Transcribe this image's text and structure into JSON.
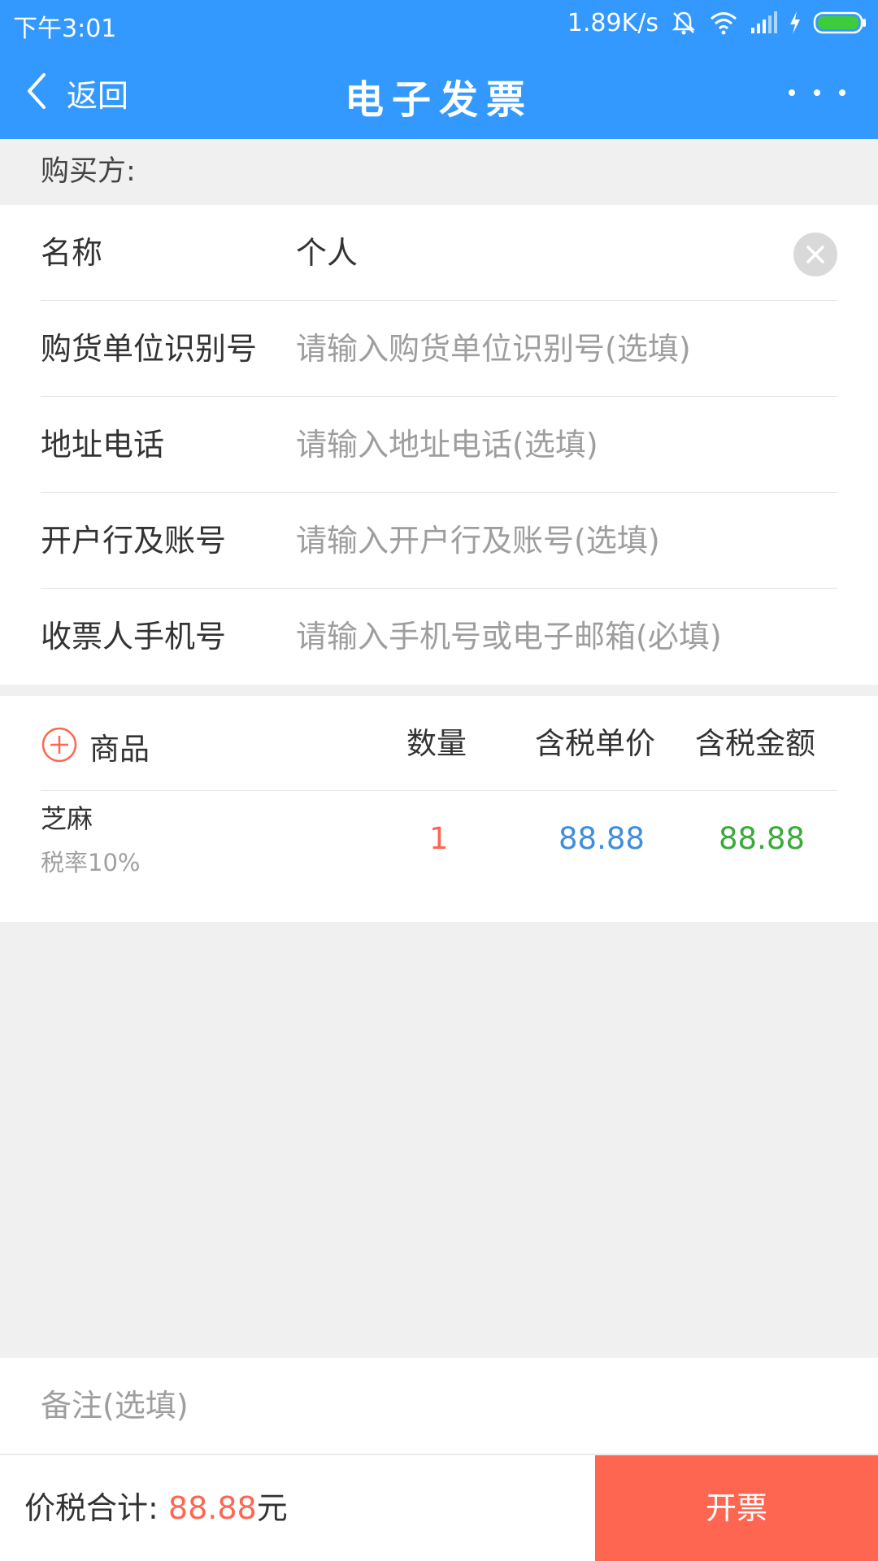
{
  "status_bar": {
    "time": "下午3:01",
    "net_speed": "1.89K/s",
    "icons": [
      "alarm-off-icon",
      "wifi-icon",
      "signal-icon",
      "charging-icon",
      "battery-icon"
    ]
  },
  "nav": {
    "back_label": "返回",
    "title": "电子发票",
    "more_icon": "more-dots-icon"
  },
  "buyer_section": {
    "label": "购买方:"
  },
  "form": {
    "name": {
      "label": "名称",
      "value": "个人"
    },
    "tax_id": {
      "label": "购货单位识别号",
      "placeholder": "请输入购货单位识别号(选填)"
    },
    "address_phone": {
      "label": "地址电话",
      "placeholder": "请输入地址电话(选填)"
    },
    "bank_account": {
      "label": "开户行及账号",
      "placeholder": "请输入开户行及账号(选填)"
    },
    "receiver": {
      "label": "收票人手机号",
      "placeholder": "请输入手机号或电子邮箱(必填)"
    }
  },
  "goods": {
    "headers": {
      "item": "商品",
      "qty": "数量",
      "price": "含税单价",
      "amount": "含税金额"
    },
    "items": [
      {
        "name": "芝麻",
        "tax": "税率10%",
        "qty": "1",
        "price": "88.88",
        "amount": "88.88"
      }
    ]
  },
  "note": {
    "placeholder": "备注(选填)"
  },
  "footer": {
    "total_label": "价税合计: ",
    "total_amount": "88.88",
    "currency": "元",
    "issue_button": "开票"
  },
  "colors": {
    "primary": "#3399ff",
    "accent": "#ff6651",
    "price": "#3f8edb",
    "amount": "#3aaa3a"
  }
}
